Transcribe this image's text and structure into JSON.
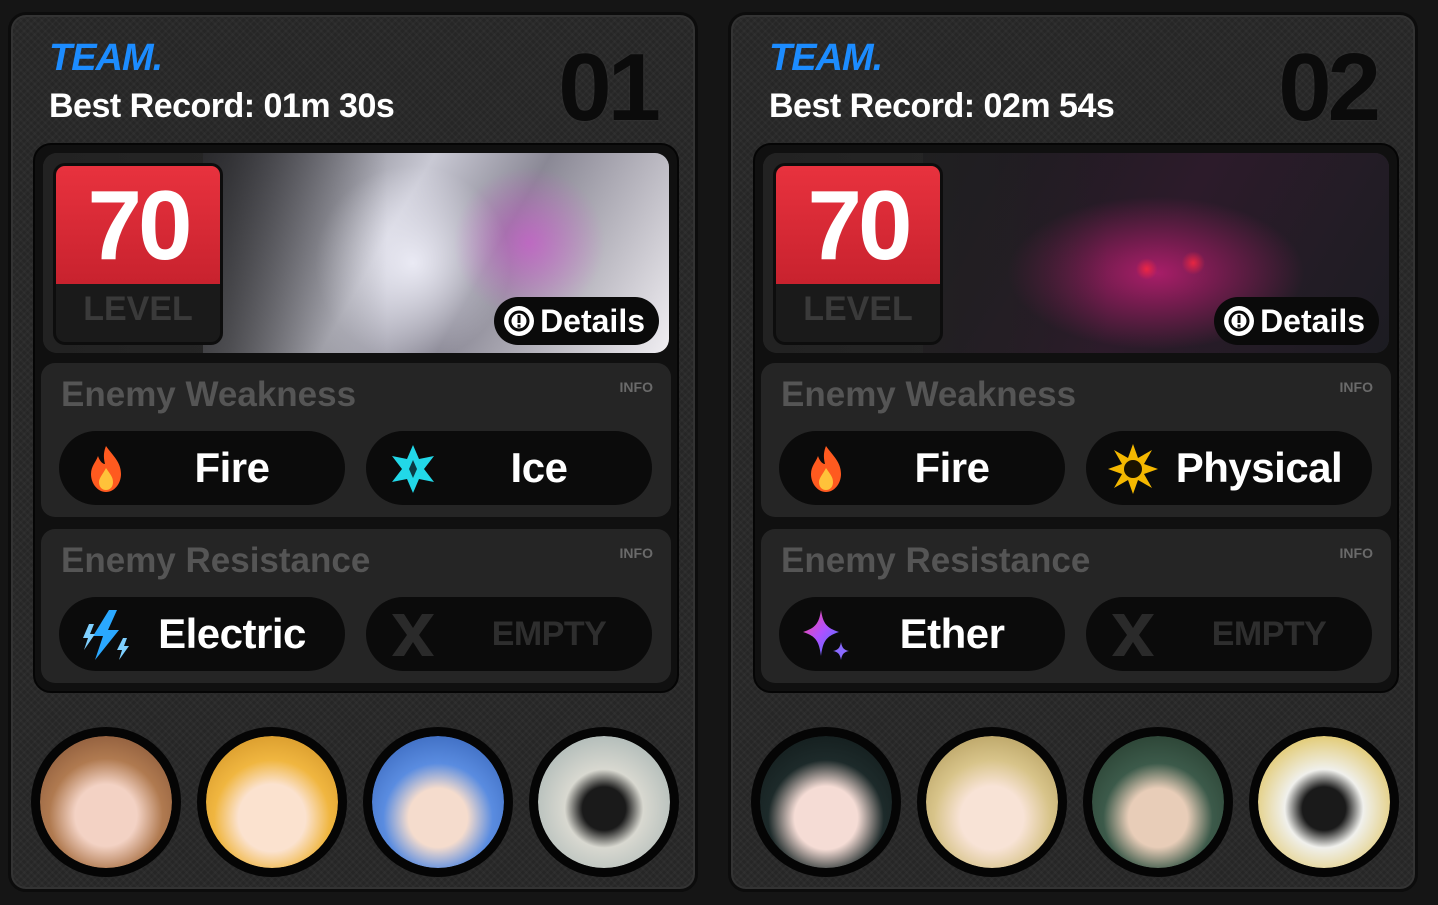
{
  "teams": [
    {
      "label": "TEAM.",
      "best_record": "Best Record: 01m 30s",
      "number": "01",
      "level": "70",
      "level_label": "LEVEL",
      "details_label": "Details",
      "weakness": {
        "title": "Enemy Weakness",
        "info": "INFO",
        "items": [
          {
            "label": "Fire",
            "icon": "fire-icon"
          },
          {
            "label": "Ice",
            "icon": "ice-icon"
          }
        ]
      },
      "resistance": {
        "title": "Enemy Resistance",
        "info": "INFO",
        "items": [
          {
            "label": "Electric",
            "icon": "electric-icon"
          },
          {
            "label": "EMPTY",
            "icon": "empty-x-icon"
          }
        ]
      },
      "members": [
        "agent-avatar",
        "agent-avatar",
        "agent-avatar",
        "bangboo-avatar"
      ]
    },
    {
      "label": "TEAM.",
      "best_record": "Best Record: 02m 54s",
      "number": "02",
      "level": "70",
      "level_label": "LEVEL",
      "details_label": "Details",
      "weakness": {
        "title": "Enemy Weakness",
        "info": "INFO",
        "items": [
          {
            "label": "Fire",
            "icon": "fire-icon"
          },
          {
            "label": "Physical",
            "icon": "physical-icon"
          }
        ]
      },
      "resistance": {
        "title": "Enemy Resistance",
        "info": "INFO",
        "items": [
          {
            "label": "Ether",
            "icon": "ether-icon"
          },
          {
            "label": "EMPTY",
            "icon": "empty-x-icon"
          }
        ]
      },
      "members": [
        "agent-avatar",
        "agent-avatar",
        "agent-avatar",
        "bangboo-avatar"
      ]
    }
  ],
  "colors": {
    "team_label": "#1c8cff",
    "level_badge": "#e8323e",
    "fire": "#ff5a1f",
    "ice": "#22d8e8",
    "electric": "#2aa8ff",
    "physical": "#f5b800",
    "ether": "#b050ff"
  }
}
